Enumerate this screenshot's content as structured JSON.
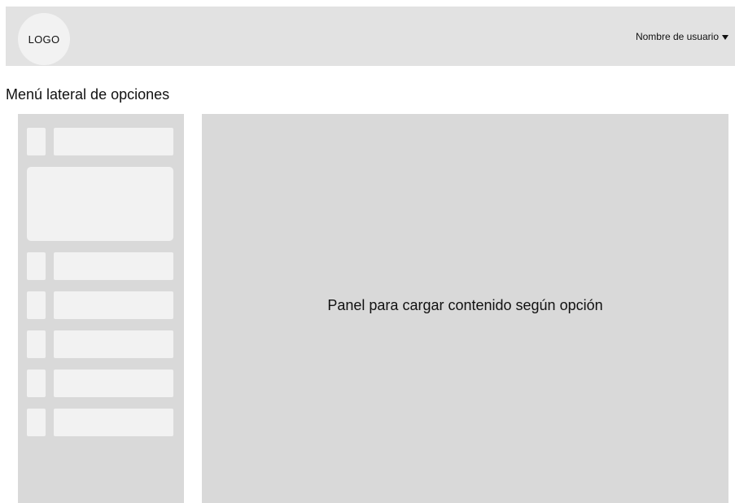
{
  "header": {
    "logo_text": "LOGO",
    "user_menu_label": "Nombre de usuario"
  },
  "page": {
    "title": "Menú lateral de opciones"
  },
  "sidebar": {
    "items": [
      {
        "icon": "placeholder-icon"
      },
      {
        "type": "card"
      },
      {
        "icon": "placeholder-icon"
      },
      {
        "icon": "placeholder-icon"
      },
      {
        "icon": "placeholder-icon"
      },
      {
        "icon": "placeholder-icon"
      },
      {
        "icon": "placeholder-icon"
      }
    ]
  },
  "main": {
    "panel_text": "Panel para cargar contenido según opción"
  },
  "colors": {
    "header_bg": "#e2e2e2",
    "panel_bg": "#d9d9d9",
    "placeholder_bg": "#f2f2f2",
    "text": "#111111"
  }
}
